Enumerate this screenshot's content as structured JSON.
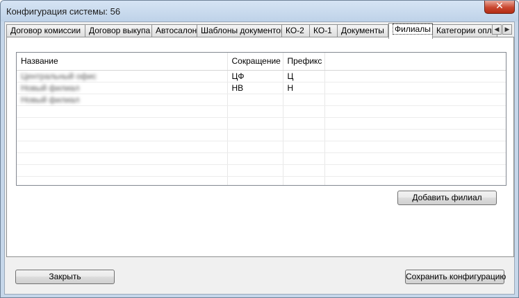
{
  "window": {
    "title": "Конфигурация системы: 56",
    "close_glyph": "✕"
  },
  "tabs": [
    {
      "label": "Договор комиссии"
    },
    {
      "label": "Договор выкупа"
    },
    {
      "label": "Автосалон"
    },
    {
      "label": "Шаблоны документов"
    },
    {
      "label": "КО-2"
    },
    {
      "label": "КО-1"
    },
    {
      "label": "Документы"
    },
    {
      "label": "Филиалы",
      "active": true
    },
    {
      "label": "Категории опла"
    }
  ],
  "tab_scroll": {
    "left": "◀",
    "right": "▶"
  },
  "grid": {
    "columns": [
      "Название",
      "Сокращение",
      "Префикс"
    ],
    "rows": [
      {
        "name": "Центральный офис",
        "short": "ЦФ",
        "prefix": "Ц"
      },
      {
        "name": "Новый филиал",
        "short": "НВ",
        "prefix": "Н"
      },
      {
        "name": "Новый филиал",
        "short": "",
        "prefix": ""
      }
    ]
  },
  "buttons": {
    "add_branch": "Добавить филиал",
    "close": "Закрыть",
    "save": "Сохранить конфигурацию"
  }
}
